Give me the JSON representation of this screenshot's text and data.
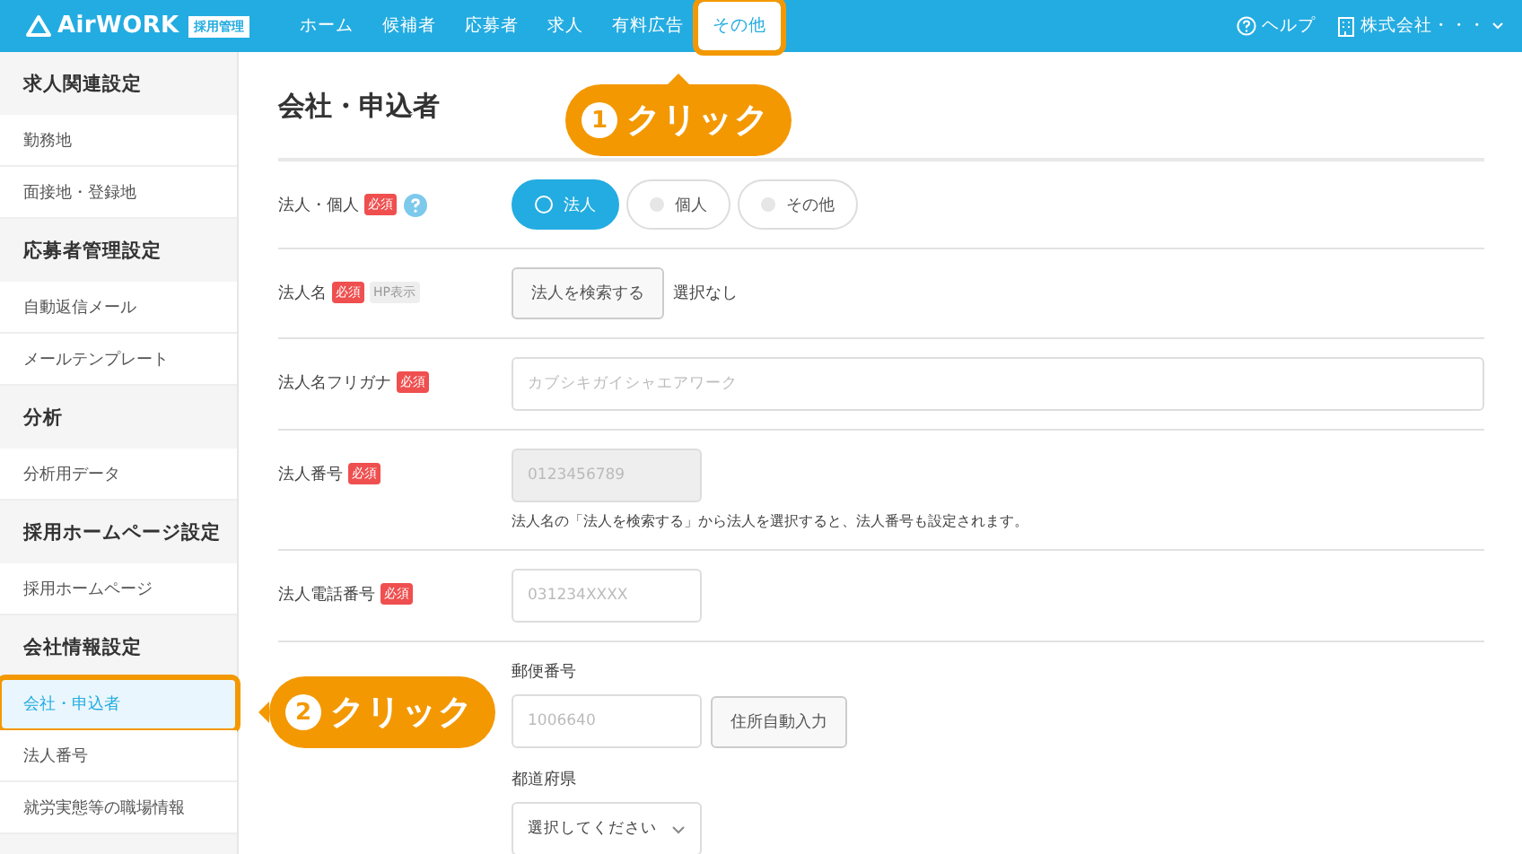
{
  "header": {
    "logo": "AirWORK",
    "logo_badge": "採用管理",
    "menu": [
      {
        "label": "ホーム",
        "selected": false,
        "highlighted": false
      },
      {
        "label": "候補者",
        "selected": false,
        "highlighted": false
      },
      {
        "label": "応募者",
        "selected": false,
        "highlighted": false
      },
      {
        "label": "求人",
        "selected": false,
        "highlighted": false
      },
      {
        "label": "有料広告",
        "selected": false,
        "highlighted": false
      },
      {
        "label": "その他",
        "selected": true,
        "highlighted": true
      }
    ],
    "help": "ヘルプ",
    "account": "株式会社・・・"
  },
  "sidebar": [
    {
      "title": "求人関連設定",
      "items": [
        {
          "label": "勤務地",
          "selected": false,
          "highlighted": false
        },
        {
          "label": "面接地・登録地",
          "selected": false,
          "highlighted": false
        }
      ]
    },
    {
      "title": "応募者管理設定",
      "items": [
        {
          "label": "自動返信メール",
          "selected": false,
          "highlighted": false
        },
        {
          "label": "メールテンプレート",
          "selected": false,
          "highlighted": false
        }
      ]
    },
    {
      "title": "分析",
      "items": [
        {
          "label": "分析用データ",
          "selected": false,
          "highlighted": false
        }
      ]
    },
    {
      "title": "採用ホームページ設定",
      "items": [
        {
          "label": "採用ホームページ",
          "selected": false,
          "highlighted": false
        }
      ]
    },
    {
      "title": "会社情報設定",
      "items": [
        {
          "label": "会社・申込者",
          "selected": true,
          "highlighted": true
        },
        {
          "label": "法人番号",
          "selected": false,
          "highlighted": false
        },
        {
          "label": "就労実態等の職場情報",
          "selected": false,
          "highlighted": false
        }
      ]
    }
  ],
  "title": "会社・申込者",
  "rows": [
    {
      "kind": "radio",
      "label": "法人・個人",
      "badges": [
        {
          "kind": "required",
          "text": "必須"
        }
      ],
      "help": true,
      "options": [
        {
          "label": "法人",
          "selected": true
        },
        {
          "label": "個人",
          "selected": false
        },
        {
          "label": "その他",
          "selected": false
        }
      ]
    },
    {
      "kind": "search",
      "label": "法人名",
      "badges": [
        {
          "kind": "required",
          "text": "必須"
        },
        {
          "kind": "hp",
          "text": "HP表示"
        }
      ],
      "button": "法人を検索する",
      "value": "選択なし"
    },
    {
      "kind": "text",
      "label": "法人名フリガナ",
      "badges": [
        {
          "kind": "required",
          "text": "必須"
        }
      ],
      "placeholder": "カブシキガイシャエアワーク",
      "wide": true,
      "disabled": false
    },
    {
      "kind": "text",
      "label": "法人番号",
      "badges": [
        {
          "kind": "required",
          "text": "必須"
        }
      ],
      "placeholder": "0123456789",
      "wide": false,
      "disabled": true,
      "note": "法人名の「法人を検索する」から法人を選択すると、法人番号も設定されます。"
    },
    {
      "kind": "text",
      "label": "法人電話番号",
      "badges": [
        {
          "kind": "required",
          "text": "必須"
        }
      ],
      "placeholder": "031234XXXX",
      "wide": false,
      "disabled": false
    },
    {
      "kind": "address",
      "postal_label": "郵便番号",
      "postal_placeholder": "1006640",
      "button": "住所自動入力",
      "pref_label": "都道府県",
      "pref_value": "選択してください"
    }
  ],
  "callouts": [
    {
      "number": "1",
      "text": "クリック"
    },
    {
      "number": "2",
      "text": "クリック"
    }
  ]
}
